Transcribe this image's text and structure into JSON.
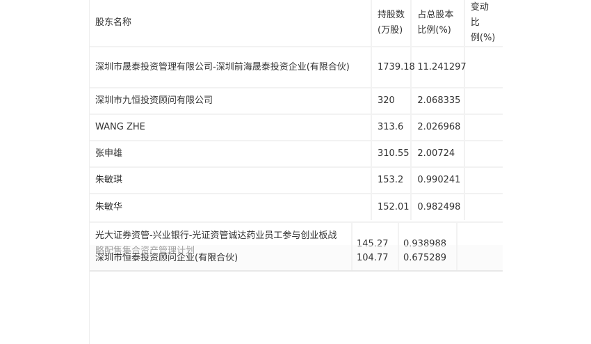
{
  "table": {
    "headers": {
      "name": "股东名称",
      "shares_line1": "持股数",
      "shares_line2": "(万股)",
      "ratio_line1": "占总股本",
      "ratio_line2": "比例(%)",
      "change_line1": "变动比",
      "change_line2": "例(%)"
    },
    "rows": [
      {
        "name": "深圳市晟泰投资管理有限公司-深圳前海晟泰投资企业(有限合伙)",
        "shares": "1739.18",
        "ratio": "11.241297",
        "change": ""
      },
      {
        "name": "深圳市九恒投资顾问有限公司",
        "shares": "320",
        "ratio": "2.068335",
        "change": ""
      },
      {
        "name": "WANG ZHE",
        "shares": "313.6",
        "ratio": "2.026968",
        "change": ""
      },
      {
        "name": "张申雄",
        "shares": "310.55",
        "ratio": "2.00724",
        "change": ""
      },
      {
        "name": "朱敏琪",
        "shares": "153.2",
        "ratio": "0.990241",
        "change": ""
      },
      {
        "name": "朱敏华",
        "shares": "152.01",
        "ratio": "0.982498",
        "change": ""
      },
      {
        "name": "光大证券资管-兴业银行-光证资管诚达药业员工参与创业板战略配售集合资产管理计划",
        "shares": "145.27",
        "ratio": "0.938988",
        "change": ""
      },
      {
        "name": "深圳市恒泰投资顾问企业(有限合伙)",
        "shares": "104.77",
        "ratio": "0.675289",
        "change": ""
      }
    ]
  }
}
